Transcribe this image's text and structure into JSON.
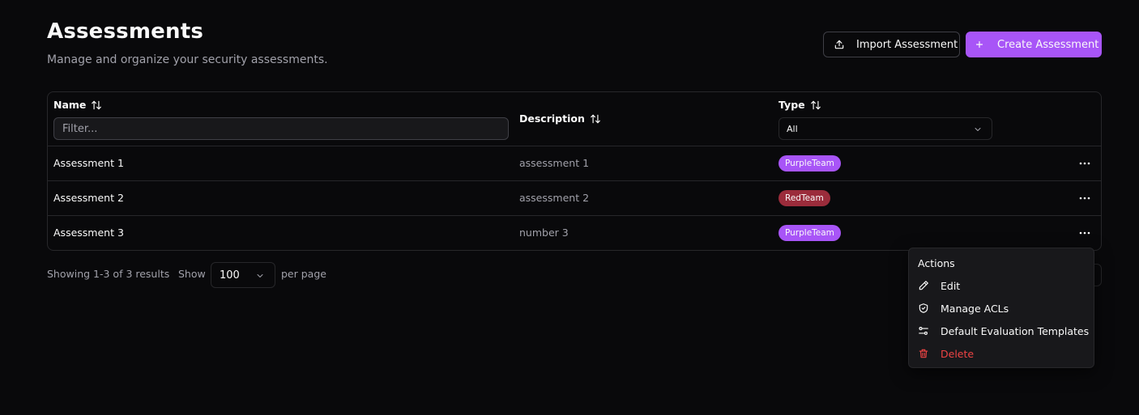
{
  "header": {
    "title": "Assessments",
    "subtitle": "Manage and organize your security assessments."
  },
  "toolbar": {
    "import_label": "Import Assessment",
    "create_label": "Create Assessment"
  },
  "table": {
    "columns": {
      "name": "Name",
      "description": "Description",
      "type": "Type"
    },
    "filter_placeholder": "Filter...",
    "type_filter_value": "All",
    "rows": [
      {
        "name": "Assessment 1",
        "description": "assessment 1",
        "type": "PurpleTeam",
        "type_color": "#a855f7"
      },
      {
        "name": "Assessment 2",
        "description": "assessment 2",
        "type": "RedTeam",
        "type_color": "#9b2c3b"
      },
      {
        "name": "Assessment 3",
        "description": "number 3",
        "type": "PurpleTeam",
        "type_color": "#a855f7"
      }
    ]
  },
  "footer": {
    "showing": "Showing 1-3 of 3 results",
    "show_label": "Show",
    "per_page_value": "100",
    "per_page_label": "per page"
  },
  "actions_menu": {
    "header": "Actions",
    "items": [
      {
        "label": "Edit",
        "icon": "pencil-icon"
      },
      {
        "label": "Manage ACLs",
        "icon": "shield-icon"
      },
      {
        "label": "Default Evaluation Templates",
        "icon": "sliders-icon"
      },
      {
        "label": "Delete",
        "icon": "trash-icon"
      }
    ]
  },
  "colors": {
    "accent": "#a855f7",
    "background": "#09090b",
    "border": "#27272a",
    "danger": "#ef4444"
  }
}
